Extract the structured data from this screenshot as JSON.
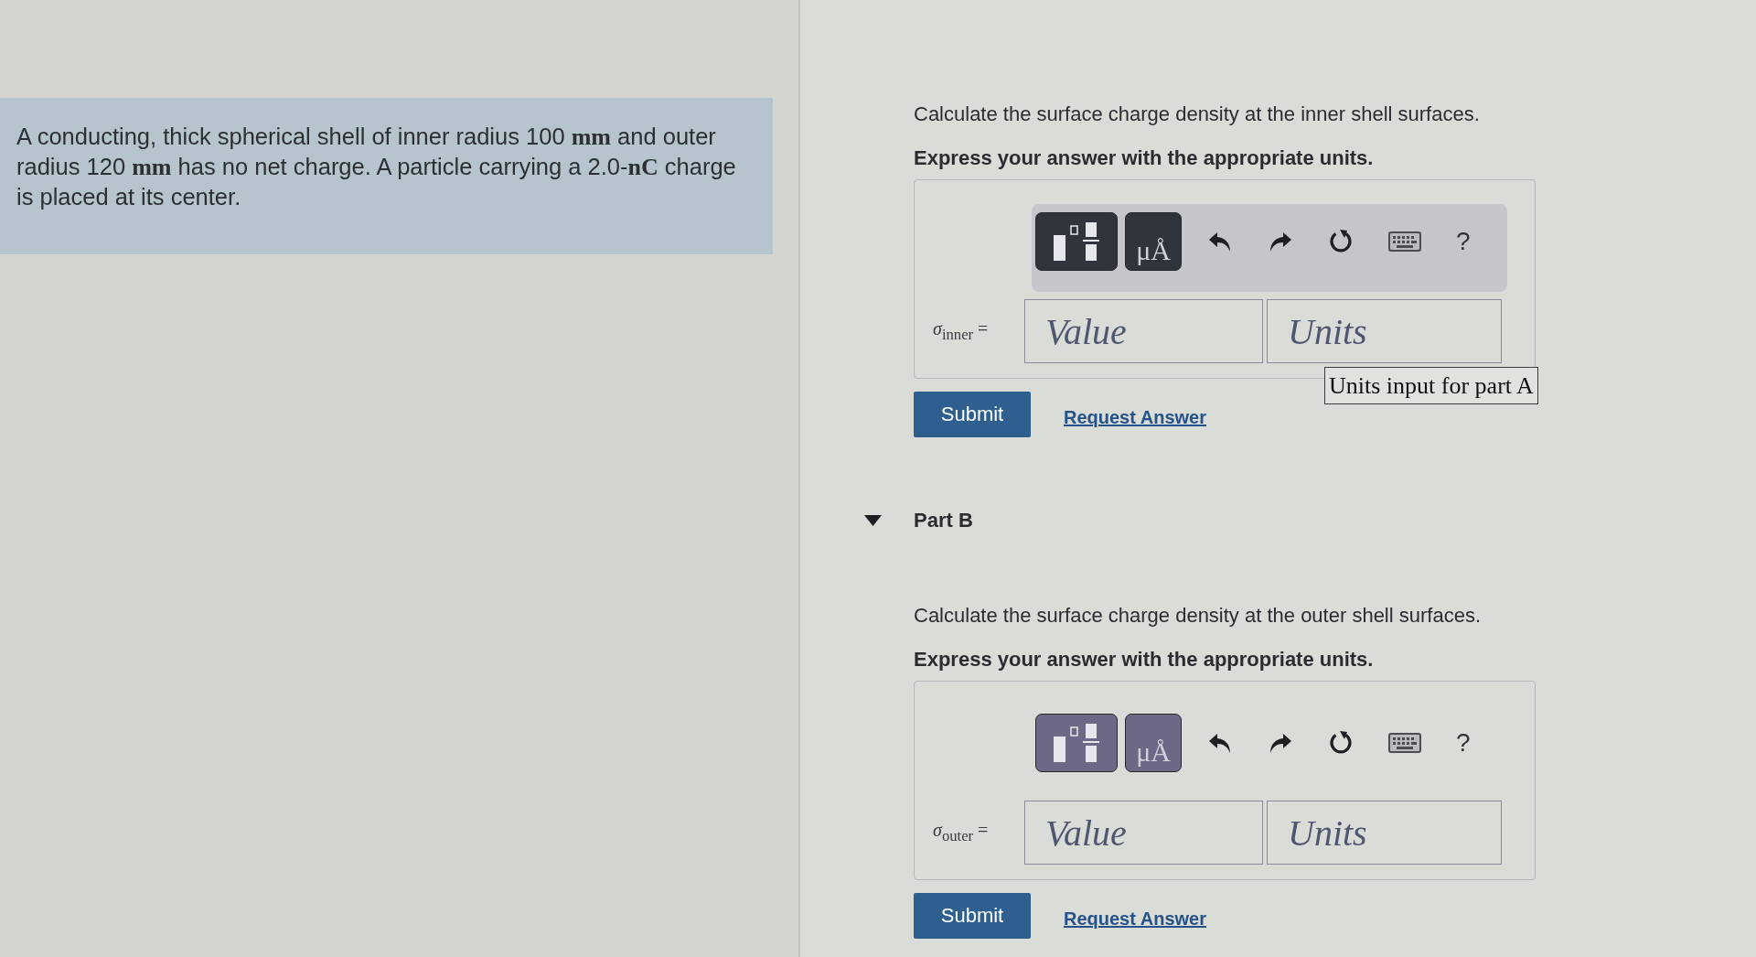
{
  "problem": {
    "segments": [
      {
        "kind": "text",
        "text": "A conducting, thick spherical shell of inner radius 100 "
      },
      {
        "kind": "unit",
        "text": "mm"
      },
      {
        "kind": "text",
        "text": " and outer radius 120 "
      },
      {
        "kind": "unit",
        "text": "mm"
      },
      {
        "kind": "text",
        "text": " has no net charge. A particle carrying a 2.0-"
      },
      {
        "kind": "unit",
        "text": "nC"
      },
      {
        "kind": "text",
        "text": " charge is placed at its center."
      }
    ]
  },
  "parts": [
    {
      "prompt": "Calculate the surface charge density at the inner shell surfaces.",
      "instruction": "Express your answer with the appropriate units.",
      "focused": true,
      "toolbar": {
        "units_label": "μÅ",
        "help_label": "?"
      },
      "answer": {
        "label": "*σ*$_{inner}$ =",
        "value_placeholder": "Value",
        "units_placeholder": "Units",
        "tooltip": "Units input for part A"
      },
      "submit": "Submit",
      "request_answer": "Request Answer"
    },
    {
      "title": "Part B",
      "expanded": true,
      "prompt": "Calculate the surface charge density at the outer shell surfaces.",
      "instruction": "Express your answer with the appropriate units.",
      "focused": false,
      "toolbar": {
        "units_label": "μÅ",
        "help_label": "?"
      },
      "answer": {
        "label": "*σ*$_{outer}$ =",
        "value_placeholder": "Value",
        "units_placeholder": "Units"
      },
      "submit": "Submit",
      "request_answer": "Request Answer"
    }
  ]
}
